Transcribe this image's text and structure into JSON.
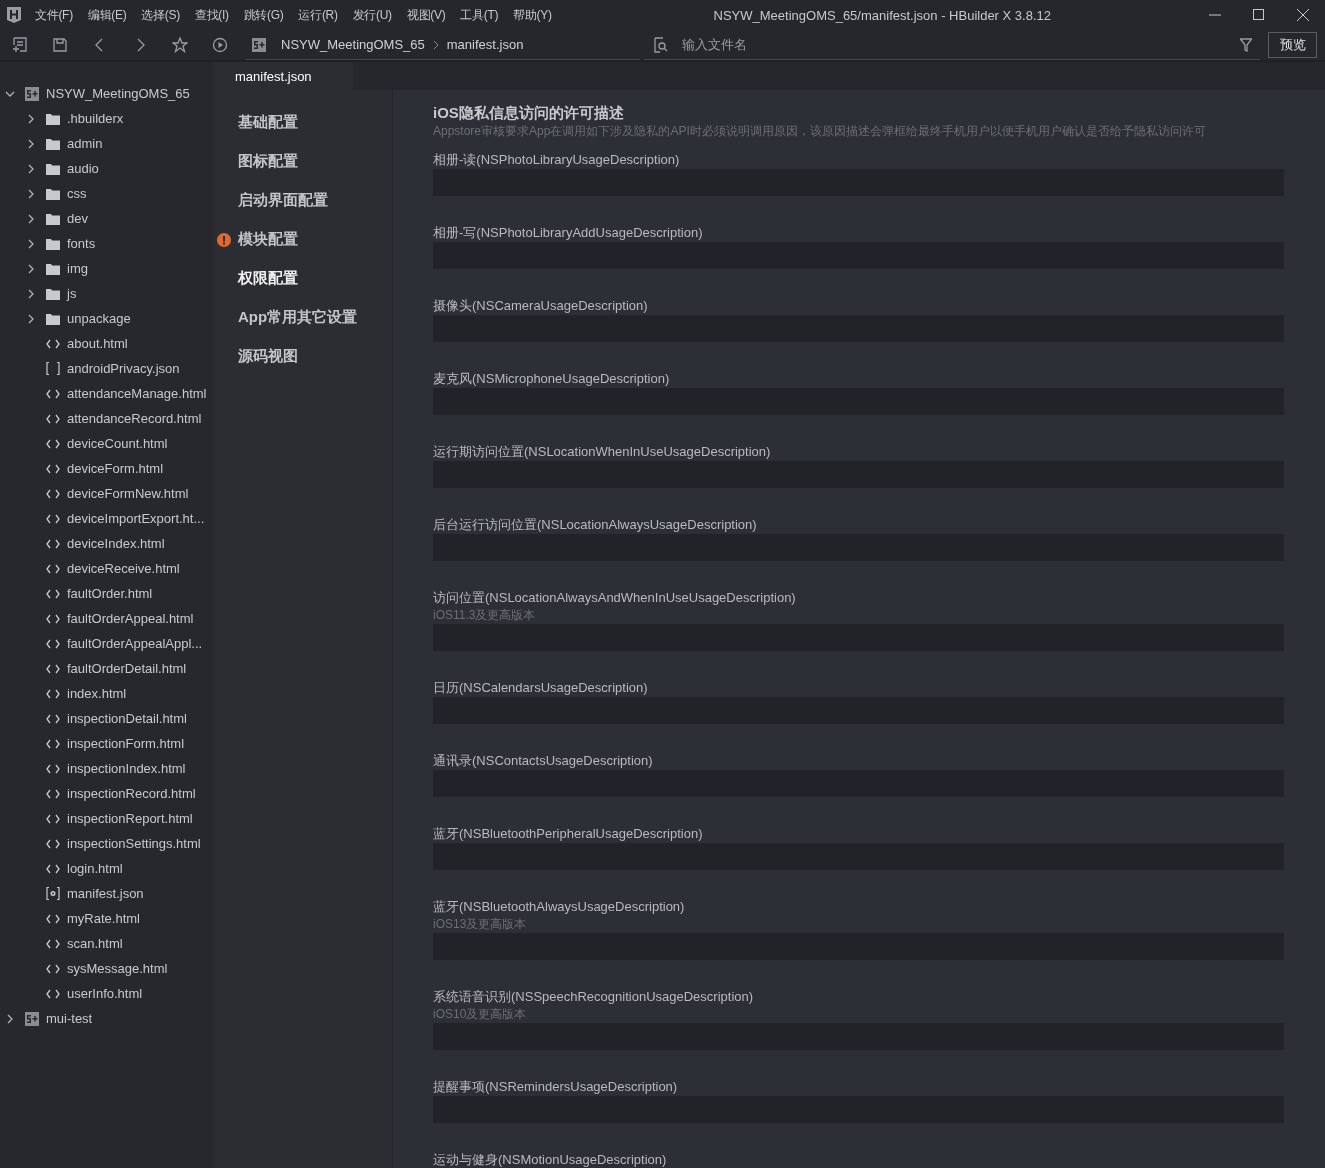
{
  "window": {
    "title": "NSYW_MeetingOMS_65/manifest.json - HBuilder X 3.8.12"
  },
  "menu": [
    "文件(F)",
    "编辑(E)",
    "选择(S)",
    "查找(I)",
    "跳转(G)",
    "运行(R)",
    "发行(U)",
    "视图(V)",
    "工具(T)",
    "帮助(Y)"
  ],
  "breadcrumb": [
    "NSYW_MeetingOMS_65",
    "manifest.json"
  ],
  "file_search": {
    "placeholder": "输入文件名"
  },
  "preview_button": "预览",
  "tree": [
    {
      "label": "NSYW_MeetingOMS_65",
      "kind": "project",
      "expanded": true,
      "children": [
        {
          "label": ".hbuilderx",
          "kind": "folder",
          "expanded": false
        },
        {
          "label": "admin",
          "kind": "folder",
          "expanded": false
        },
        {
          "label": "audio",
          "kind": "folder",
          "expanded": false
        },
        {
          "label": "css",
          "kind": "folder",
          "expanded": false
        },
        {
          "label": "dev",
          "kind": "folder",
          "expanded": false
        },
        {
          "label": "fonts",
          "kind": "folder",
          "expanded": false
        },
        {
          "label": "img",
          "kind": "folder",
          "expanded": false
        },
        {
          "label": "js",
          "kind": "folder",
          "expanded": false
        },
        {
          "label": "unpackage",
          "kind": "folder",
          "expanded": false
        },
        {
          "label": "about.html",
          "kind": "html"
        },
        {
          "label": "androidPrivacy.json",
          "kind": "json"
        },
        {
          "label": "attendanceManage.html",
          "kind": "html"
        },
        {
          "label": "attendanceRecord.html",
          "kind": "html"
        },
        {
          "label": "deviceCount.html",
          "kind": "html"
        },
        {
          "label": "deviceForm.html",
          "kind": "html"
        },
        {
          "label": "deviceFormNew.html",
          "kind": "html"
        },
        {
          "label": "deviceImportExport.ht...",
          "kind": "html"
        },
        {
          "label": "deviceIndex.html",
          "kind": "html"
        },
        {
          "label": "deviceReceive.html",
          "kind": "html"
        },
        {
          "label": "faultOrder.html",
          "kind": "html"
        },
        {
          "label": "faultOrderAppeal.html",
          "kind": "html"
        },
        {
          "label": "faultOrderAppealAppl...",
          "kind": "html"
        },
        {
          "label": "faultOrderDetail.html",
          "kind": "html"
        },
        {
          "label": "index.html",
          "kind": "html"
        },
        {
          "label": "inspectionDetail.html",
          "kind": "html"
        },
        {
          "label": "inspectionForm.html",
          "kind": "html"
        },
        {
          "label": "inspectionIndex.html",
          "kind": "html"
        },
        {
          "label": "inspectionRecord.html",
          "kind": "html"
        },
        {
          "label": "inspectionReport.html",
          "kind": "html"
        },
        {
          "label": "inspectionSettings.html",
          "kind": "html"
        },
        {
          "label": "login.html",
          "kind": "html"
        },
        {
          "label": "manifest.json",
          "kind": "manifest"
        },
        {
          "label": "myRate.html",
          "kind": "html"
        },
        {
          "label": "scan.html",
          "kind": "html"
        },
        {
          "label": "sysMessage.html",
          "kind": "html"
        },
        {
          "label": "userInfo.html",
          "kind": "html"
        }
      ]
    },
    {
      "label": "mui-test",
      "kind": "project",
      "expanded": false
    }
  ],
  "tabs": [
    {
      "label": "manifest.json",
      "selected": true
    }
  ],
  "config_nav": [
    {
      "label": "基础配置",
      "selected": false,
      "warning": false
    },
    {
      "label": "图标配置",
      "selected": false,
      "warning": false
    },
    {
      "label": "启动界面配置",
      "selected": false,
      "warning": false
    },
    {
      "label": "模块配置",
      "selected": false,
      "warning": true
    },
    {
      "label": "权限配置",
      "selected": true,
      "warning": false
    },
    {
      "label": "App常用其它设置",
      "selected": false,
      "warning": false
    },
    {
      "label": "源码视图",
      "selected": false,
      "warning": false
    }
  ],
  "section": {
    "title": "iOS隐私信息访问的许可描述",
    "description": "Appstore审核要求App在调用如下涉及隐私的API时必须说明调用原因，该原因描述会弹框给最终手机用户以便手机用户确认是否给予隐私访问许可"
  },
  "fields": [
    {
      "label": "相册-读(NSPhotoLibraryUsageDescription)"
    },
    {
      "label": "相册-写(NSPhotoLibraryAddUsageDescription)"
    },
    {
      "label": "摄像头(NSCameraUsageDescription)"
    },
    {
      "label": "麦克风(NSMicrophoneUsageDescription)"
    },
    {
      "label": "运行期访问位置(NSLocationWhenInUseUsageDescription)"
    },
    {
      "label": "后台运行访问位置(NSLocationAlwaysUsageDescription)"
    },
    {
      "label": "访问位置(NSLocationAlwaysAndWhenInUseUsageDescription)",
      "note": "iOS11.3及更高版本"
    },
    {
      "label": "日历(NSCalendarsUsageDescription)"
    },
    {
      "label": "通讯录(NSContactsUsageDescription)"
    },
    {
      "label": "蓝牙(NSBluetoothPeripheralUsageDescription)"
    },
    {
      "label": "蓝牙(NSBluetoothAlwaysUsageDescription)",
      "note": "iOS13及更高版本"
    },
    {
      "label": "系统语音识别(NSSpeechRecognitionUsageDescription)",
      "note": "iOS10及更高版本"
    },
    {
      "label": "提醒事项(NSRemindersUsageDescription)"
    },
    {
      "label": "运动与健身(NSMotionUsageDescription)"
    }
  ]
}
